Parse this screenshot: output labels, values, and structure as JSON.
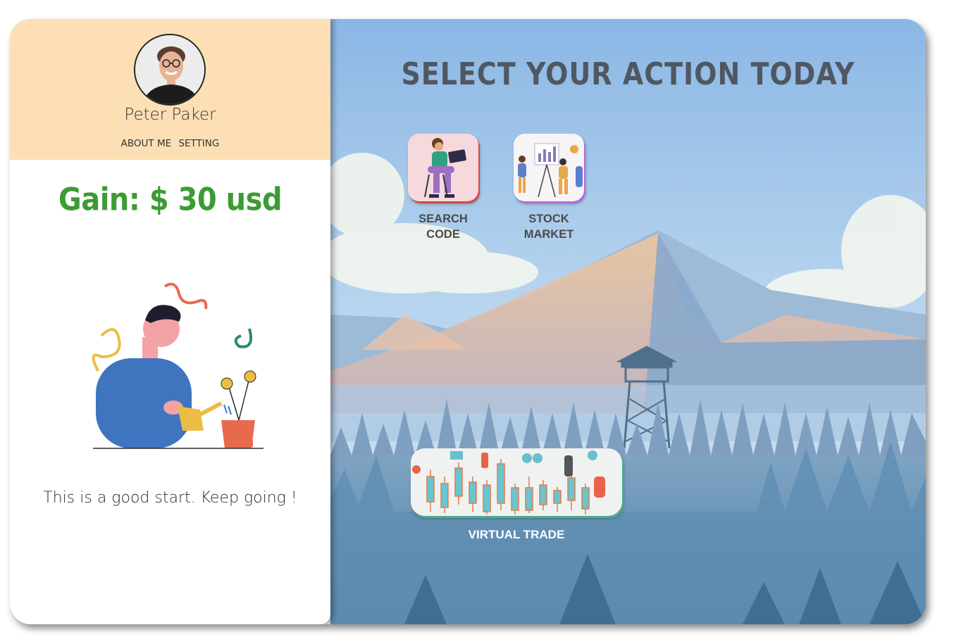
{
  "profile": {
    "name": "Peter Paker",
    "nav": {
      "about_label": "ABOUT ME",
      "setting_label": "SETTING"
    },
    "gain_text": "Gain: $ 30 usd",
    "message": "This is a good start. Keep going !"
  },
  "main": {
    "title": "SELECT YOUR ACTION TODAY",
    "actions": [
      {
        "label_line1": "SEARCH",
        "label_line2": "CODE",
        "icon": "person-laptop-illustration"
      },
      {
        "label_line1": "STOCK",
        "label_line2": "MARKET",
        "icon": "presentation-chart-illustration"
      },
      {
        "label": "VIRTUAL TRADE",
        "icon": "candlestick-trading-illustration"
      }
    ]
  },
  "colors": {
    "panel_header": "#fddfb5",
    "gain": "#3d9b35",
    "title": "#4f5862",
    "sky": "#8fb9e6"
  }
}
